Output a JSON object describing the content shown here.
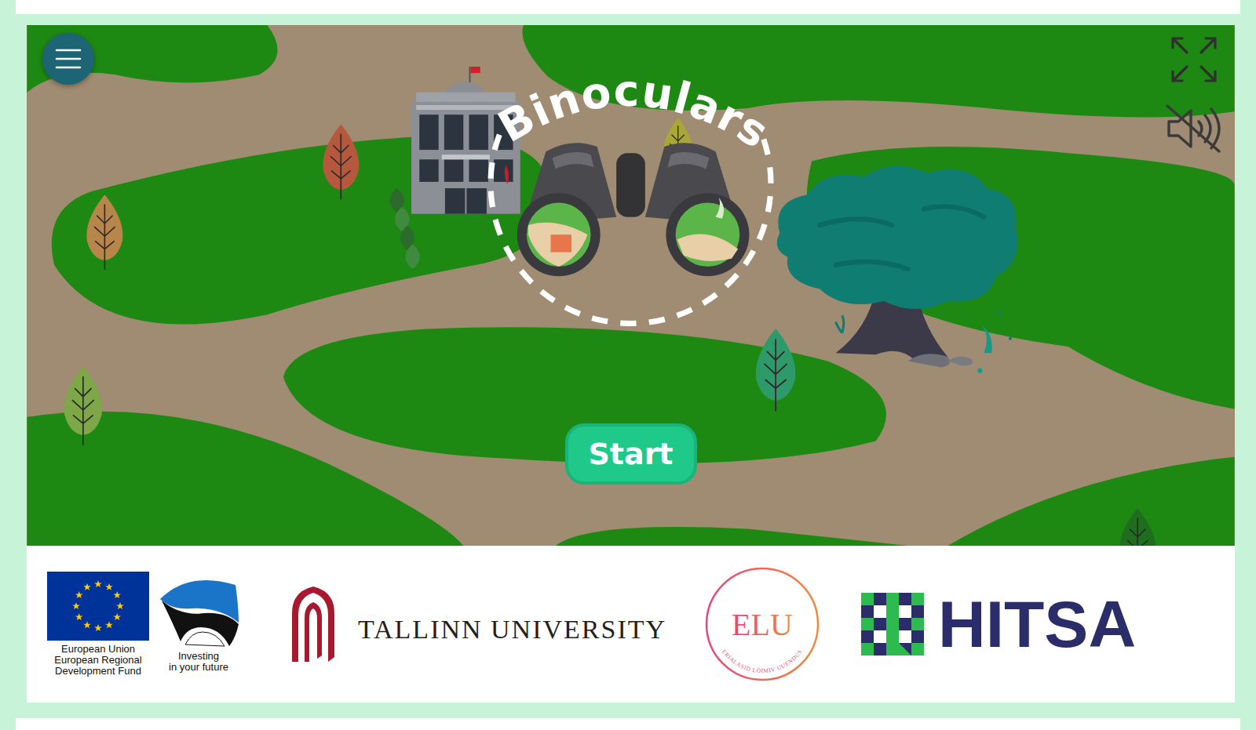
{
  "game": {
    "title": "Binoculars",
    "start_button": "Start",
    "sound_muted": true
  },
  "logos": {
    "eu": {
      "lines": [
        "European Union",
        "European Regional",
        "Development Fund"
      ]
    },
    "estonia": {
      "lines": [
        "Investing",
        "in your future"
      ]
    },
    "university": "TALLINN UNIVERSITY",
    "elu": {
      "name": "ELU",
      "motto": "ERIALASID LÕIMIV UUENDUS"
    },
    "hitsa": "HITSA"
  }
}
